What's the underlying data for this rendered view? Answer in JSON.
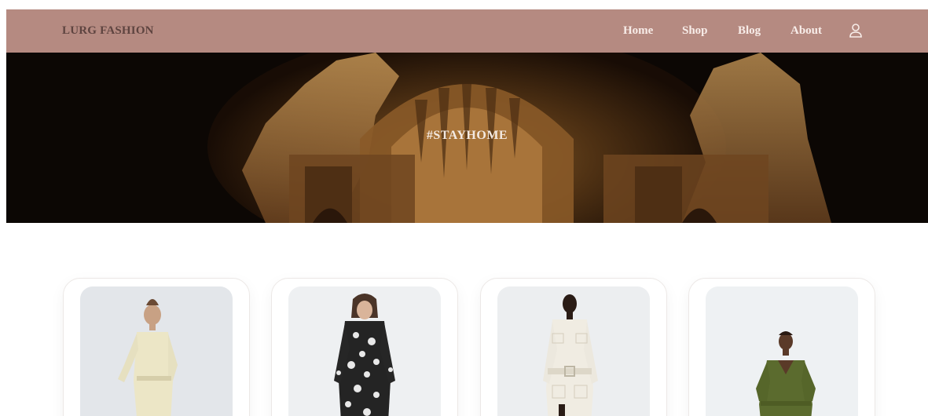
{
  "header": {
    "brand": "LURG FASHION",
    "nav": [
      {
        "label": "Home"
      },
      {
        "label": "Shop"
      },
      {
        "label": "Blog"
      },
      {
        "label": "About"
      }
    ],
    "user_icon": "user-icon",
    "background": "#b58a81"
  },
  "hero": {
    "title": "#STAYHOME"
  },
  "products": [
    {
      "image": "cream-lace-dress",
      "background": "#e3e6ea"
    },
    {
      "image": "black-floral-dress",
      "background": "#eef0f2"
    },
    {
      "image": "white-belted-jacket",
      "background": "#eceef0"
    },
    {
      "image": "olive-vneck-dress",
      "background": "#eef1f3"
    }
  ]
}
